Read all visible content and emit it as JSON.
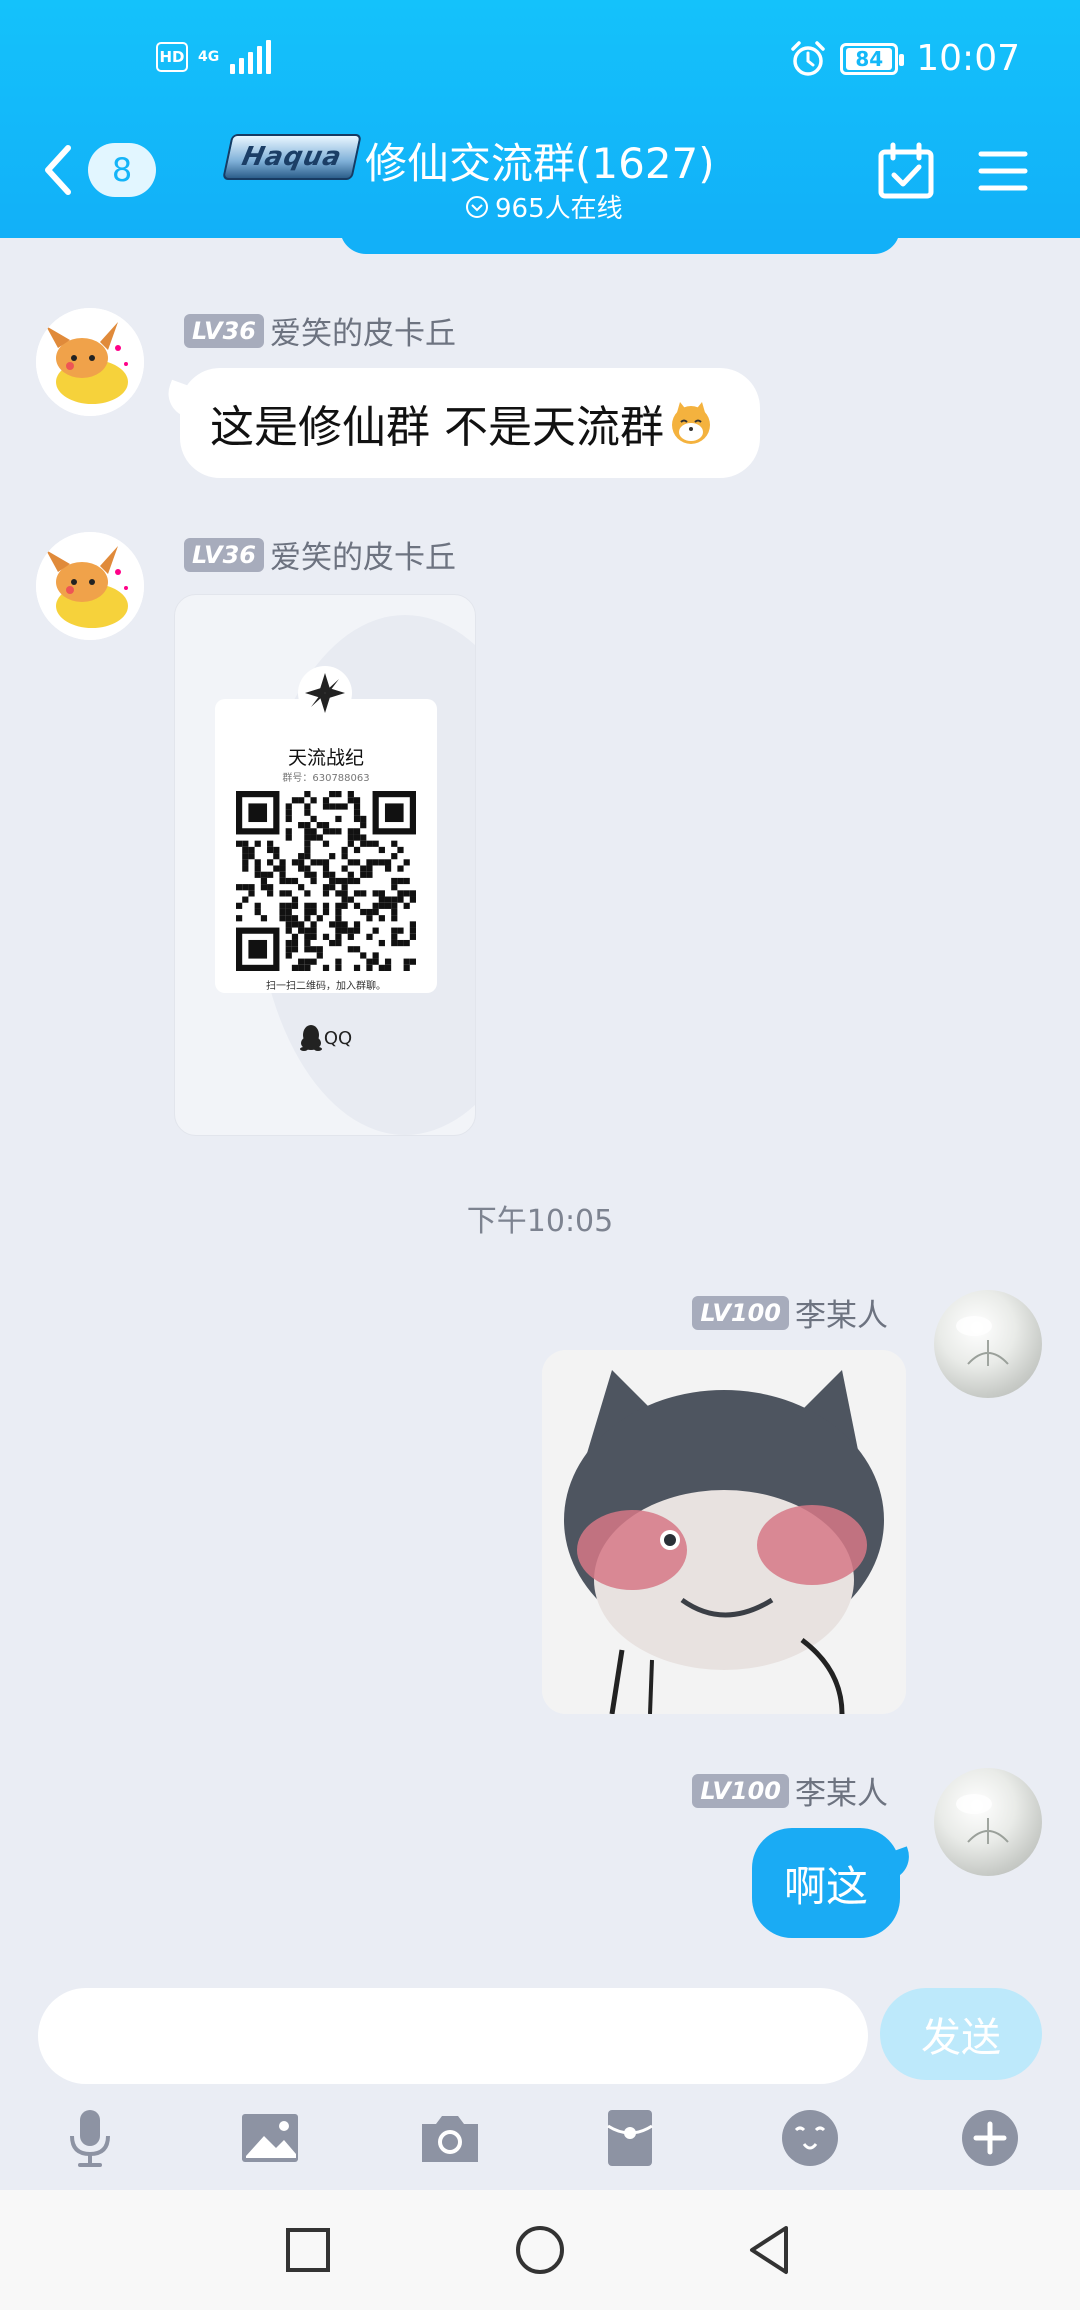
{
  "status_bar": {
    "hd": "HD",
    "network": "4G",
    "battery": "84",
    "time": "10:07"
  },
  "nav": {
    "unread_count": "8",
    "group_logo_text": "Haqua",
    "group_title": "修仙交流群(1627)",
    "online": "965人在线"
  },
  "messages": [
    {
      "side": "left",
      "level": "LV36",
      "sender": "爱笑的皮卡丘",
      "type": "text",
      "text": "这是修仙群 不是天流群",
      "emoji": "shiba-icon"
    },
    {
      "side": "left",
      "level": "LV36",
      "sender": "爱笑的皮卡丘",
      "type": "qr_card",
      "qr": {
        "group_name": "天流战纪",
        "group_number": "群号：630788063",
        "hint": "扫一扫二维码，加入群聊。",
        "brand": "QQ"
      }
    },
    {
      "type": "timestamp",
      "text": "下午10:05"
    },
    {
      "side": "right",
      "level": "LV100",
      "sender": "李某人",
      "type": "sticker",
      "sticker": "shiba-dog-sticker"
    },
    {
      "side": "right",
      "level": "LV100",
      "sender": "李某人",
      "type": "text",
      "text": "啊这"
    }
  ],
  "input": {
    "placeholder": "",
    "send_label": "发送"
  },
  "toolbar": [
    "microphone-icon",
    "image-icon",
    "camera-icon",
    "red-packet-icon",
    "emoji-icon",
    "plus-icon"
  ],
  "colors": {
    "header": "#14c2fb",
    "bubble_right": "#1aabf4",
    "bubble_left": "#ffffff",
    "background": "#eaedf4",
    "send_disabled": "#bde9fb",
    "level_badge": "#a7acbc"
  }
}
